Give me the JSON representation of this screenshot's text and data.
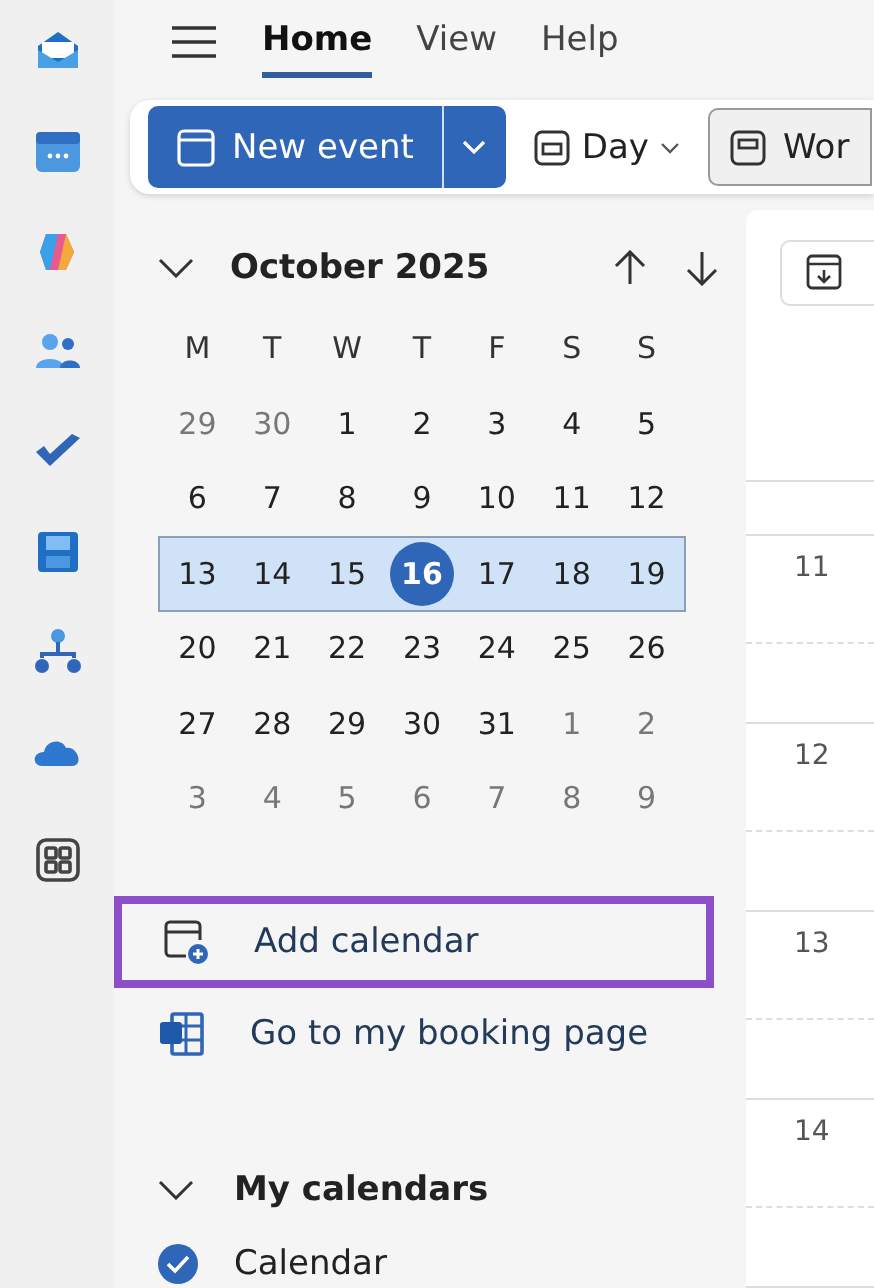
{
  "menu_tabs": [
    {
      "label": "Home",
      "selected": true
    },
    {
      "label": "View",
      "selected": false
    },
    {
      "label": "Help",
      "selected": false
    }
  ],
  "ribbon": {
    "new_event": "New event",
    "view_picker": "Day",
    "work_week": "Wor"
  },
  "mini_calendar": {
    "title": "October 2025",
    "weekdays": [
      "M",
      "T",
      "W",
      "T",
      "F",
      "S",
      "S"
    ],
    "weeks": [
      {
        "selected": false,
        "days": [
          {
            "day": "29",
            "outside": true,
            "today": false
          },
          {
            "day": "30",
            "outside": true,
            "today": false
          },
          {
            "day": "1",
            "outside": false,
            "today": false
          },
          {
            "day": "2",
            "outside": false,
            "today": false
          },
          {
            "day": "3",
            "outside": false,
            "today": false
          },
          {
            "day": "4",
            "outside": false,
            "today": false
          },
          {
            "day": "5",
            "outside": false,
            "today": false
          }
        ]
      },
      {
        "selected": false,
        "days": [
          {
            "day": "6",
            "outside": false,
            "today": false
          },
          {
            "day": "7",
            "outside": false,
            "today": false
          },
          {
            "day": "8",
            "outside": false,
            "today": false
          },
          {
            "day": "9",
            "outside": false,
            "today": false
          },
          {
            "day": "10",
            "outside": false,
            "today": false
          },
          {
            "day": "11",
            "outside": false,
            "today": false
          },
          {
            "day": "12",
            "outside": false,
            "today": false
          }
        ]
      },
      {
        "selected": true,
        "days": [
          {
            "day": "13",
            "outside": false,
            "today": false
          },
          {
            "day": "14",
            "outside": false,
            "today": false
          },
          {
            "day": "15",
            "outside": false,
            "today": false
          },
          {
            "day": "16",
            "outside": false,
            "today": true
          },
          {
            "day": "17",
            "outside": false,
            "today": false
          },
          {
            "day": "18",
            "outside": false,
            "today": false
          },
          {
            "day": "19",
            "outside": false,
            "today": false
          }
        ]
      },
      {
        "selected": false,
        "days": [
          {
            "day": "20",
            "outside": false,
            "today": false
          },
          {
            "day": "21",
            "outside": false,
            "today": false
          },
          {
            "day": "22",
            "outside": false,
            "today": false
          },
          {
            "day": "23",
            "outside": false,
            "today": false
          },
          {
            "day": "24",
            "outside": false,
            "today": false
          },
          {
            "day": "25",
            "outside": false,
            "today": false
          },
          {
            "day": "26",
            "outside": false,
            "today": false
          }
        ]
      },
      {
        "selected": false,
        "days": [
          {
            "day": "27",
            "outside": false,
            "today": false
          },
          {
            "day": "28",
            "outside": false,
            "today": false
          },
          {
            "day": "29",
            "outside": false,
            "today": false
          },
          {
            "day": "30",
            "outside": false,
            "today": false
          },
          {
            "day": "31",
            "outside": false,
            "today": false
          },
          {
            "day": "1",
            "outside": true,
            "today": false
          },
          {
            "day": "2",
            "outside": true,
            "today": false
          }
        ]
      },
      {
        "selected": false,
        "days": [
          {
            "day": "3",
            "outside": true,
            "today": false
          },
          {
            "day": "4",
            "outside": true,
            "today": false
          },
          {
            "day": "5",
            "outside": true,
            "today": false
          },
          {
            "day": "6",
            "outside": true,
            "today": false
          },
          {
            "day": "7",
            "outside": true,
            "today": false
          },
          {
            "day": "8",
            "outside": true,
            "today": false
          },
          {
            "day": "9",
            "outside": true,
            "today": false
          }
        ]
      }
    ]
  },
  "links": [
    {
      "kind": "add",
      "label": "Add calendar",
      "highlighted": true
    },
    {
      "kind": "booking",
      "label": "Go to my booking page",
      "highlighted": false
    }
  ],
  "my_calendars": {
    "title": "My calendars",
    "expanded": true,
    "items": [
      {
        "label": "Calendar",
        "checked": true
      }
    ]
  },
  "hours": [
    "11",
    "12",
    "13",
    "14"
  ]
}
